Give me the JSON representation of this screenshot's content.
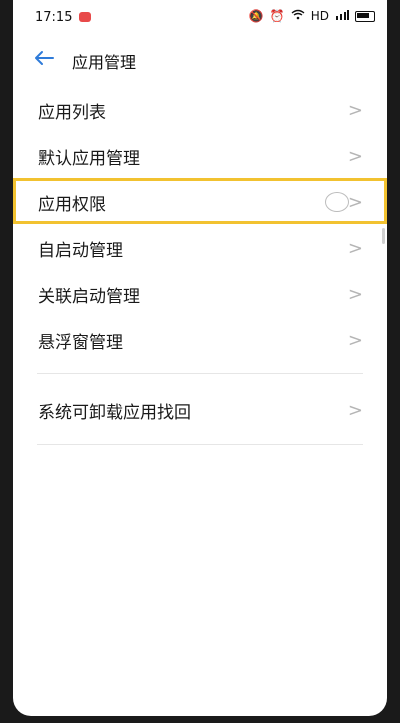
{
  "status_bar": {
    "time": "17:15",
    "icons": [
      "notification-badge",
      "mute-icon",
      "alarm-icon",
      "wifi-icon",
      "hd-label",
      "signal-icon",
      "battery-icon"
    ],
    "hd": "HD"
  },
  "header": {
    "title": "应用管理",
    "back_icon": "arrow-left-icon",
    "accent_color": "#2f7bd9"
  },
  "menu": {
    "items": [
      {
        "label": "应用列表"
      },
      {
        "label": "默认应用管理"
      },
      {
        "label": "应用权限",
        "highlighted": true
      },
      {
        "label": "自启动管理"
      },
      {
        "label": "关联启动管理"
      },
      {
        "label": "悬浮窗管理"
      }
    ],
    "recover": {
      "label": "系统可卸载应用找回"
    }
  },
  "colors": {
    "highlight_border": "#f2c230",
    "chevron": "#b5b5b5",
    "divider": "#e6e6e6"
  }
}
